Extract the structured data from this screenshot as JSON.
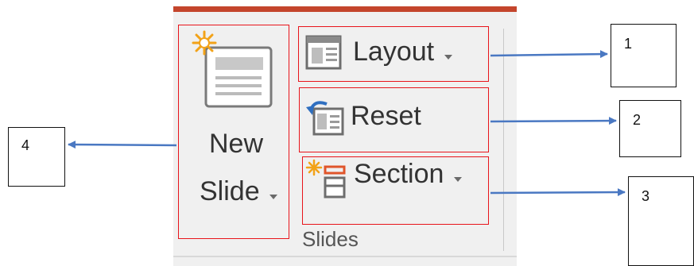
{
  "ribbon": {
    "accent_color": "#c4452c",
    "group_label": "Slides",
    "new_slide": {
      "line1": "New",
      "line2": "Slide",
      "icon": "new-slide-icon"
    },
    "layout": {
      "label": "Layout",
      "icon": "layout-icon"
    },
    "reset": {
      "label": "Reset",
      "icon": "reset-icon"
    },
    "section": {
      "label": "Section",
      "icon": "section-icon"
    }
  },
  "annotations": {
    "highlight_color": "#e8141b",
    "arrow_color": "#4a78c2",
    "callouts": [
      {
        "number": "1",
        "target": "Layout"
      },
      {
        "number": "2",
        "target": "Reset"
      },
      {
        "number": "3",
        "target": "Section"
      },
      {
        "number": "4",
        "target": "New Slide"
      }
    ]
  }
}
